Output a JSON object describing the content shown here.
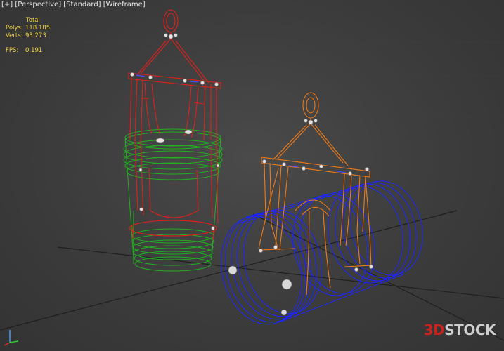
{
  "viewport": {
    "menu": {
      "plus": "[+]",
      "view": "[Perspective]",
      "shading": "[Standard]",
      "mode": "[Wireframe]"
    },
    "stats": {
      "header": "Total",
      "polys_label": "Polys:",
      "polys_value": "118.185",
      "verts_label": "Verts:",
      "verts_value": "93.273",
      "fps_label": "FPS:",
      "fps_value": "0.191"
    },
    "watermark": {
      "part1": "3D",
      "part2": "STOCK"
    },
    "colors": {
      "background": "#3a3a3a",
      "grid": "#1e1e1e",
      "stats_text": "#f0d33a",
      "lifter_red": "#e0211c",
      "drum_green": "#22b022",
      "lifter_orange": "#f07a17",
      "drum_blue": "#1a24ff",
      "watermark_red": "#c8231c"
    },
    "objects": [
      "red-lifting-clamp",
      "green-drum",
      "orange-lifting-clamp",
      "blue-drum"
    ]
  }
}
